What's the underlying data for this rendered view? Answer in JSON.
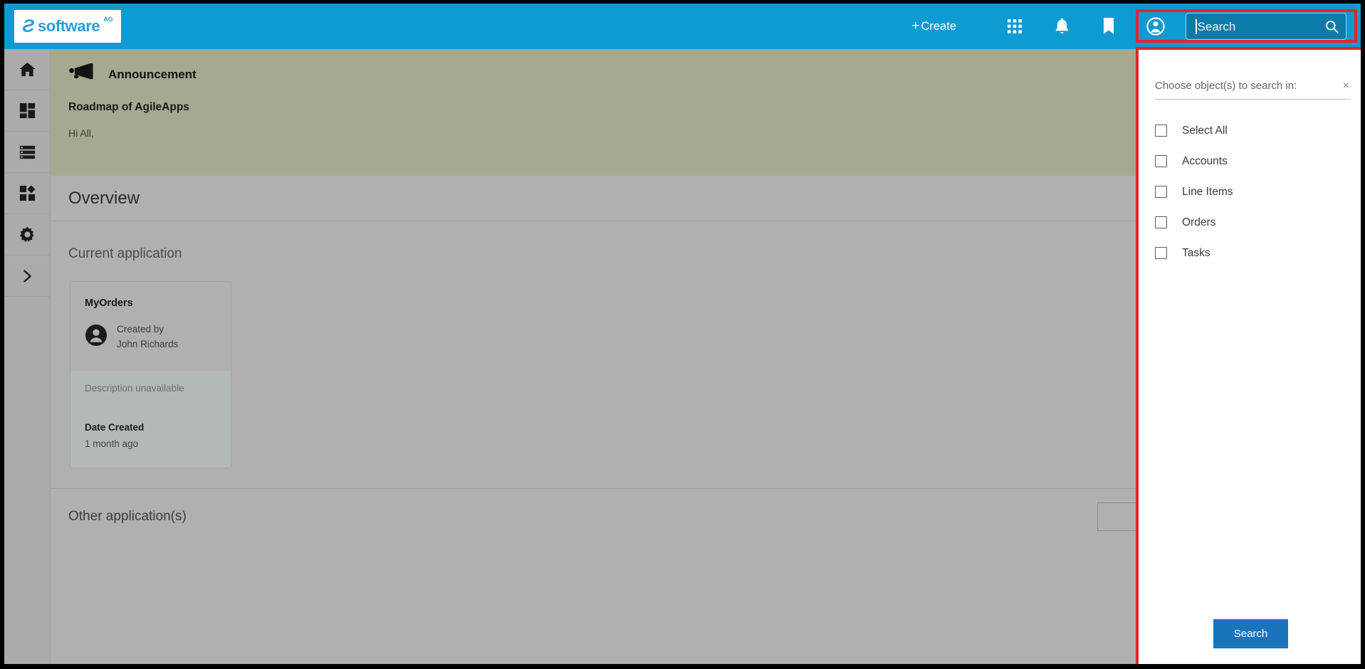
{
  "header": {
    "logo": {
      "mark": "Ƨ",
      "word": "software",
      "sup": "AG"
    },
    "create_label": "Create",
    "create_plus": "+",
    "icons": [
      {
        "name": "apps-grid-icon"
      },
      {
        "name": "notifications-bell-icon"
      },
      {
        "name": "bookmark-icon"
      },
      {
        "name": "account-circle-icon"
      }
    ],
    "search": {
      "placeholder": "Search",
      "value": "",
      "display_text": "Search"
    }
  },
  "sidebar": {
    "items": [
      {
        "name": "home",
        "icon": "home-icon"
      },
      {
        "name": "dashboard",
        "icon": "dashboard-grid-icon"
      },
      {
        "name": "list",
        "icon": "list-icon"
      },
      {
        "name": "apps",
        "icon": "apps-diamond-icon"
      },
      {
        "name": "settings",
        "icon": "gear-icon"
      },
      {
        "name": "expand",
        "icon": "chevron-right-icon"
      }
    ]
  },
  "main": {
    "announcement": {
      "icon": "megaphone-icon",
      "title": "Announcement",
      "subject": "Roadmap of AgileApps",
      "body": "Hi All,"
    },
    "overview_title": "Overview",
    "current_application_title": "Current application",
    "app_card": {
      "name": "MyOrders",
      "avatar_icon": "user-avatar-icon",
      "created_by_label": "Created by",
      "created_by_name": "John Richards",
      "description": "Description unavailable",
      "date_created_label": "Date Created",
      "date_created_value": "1 month ago"
    },
    "other_applications_title": "Other application(s)",
    "other_filter_value": "",
    "other_filter_placeholder": ""
  },
  "search_panel": {
    "heading": "Choose object(s) to search in:",
    "close_icon": "×",
    "options": [
      {
        "label": "Select All",
        "checked": false
      },
      {
        "label": "Accounts",
        "checked": false
      },
      {
        "label": "Line Items",
        "checked": false
      },
      {
        "label": "Orders",
        "checked": false
      },
      {
        "label": "Tasks",
        "checked": false
      }
    ],
    "submit_label": "Search"
  },
  "colors": {
    "header_blue": "#0e9bd1",
    "search_field_blue": "#0b7ca8",
    "highlight_red": "#e8232a",
    "button_blue": "#1a74ba",
    "announcement_olive": "#a6a890",
    "page_gray": "#b0b0b0"
  }
}
